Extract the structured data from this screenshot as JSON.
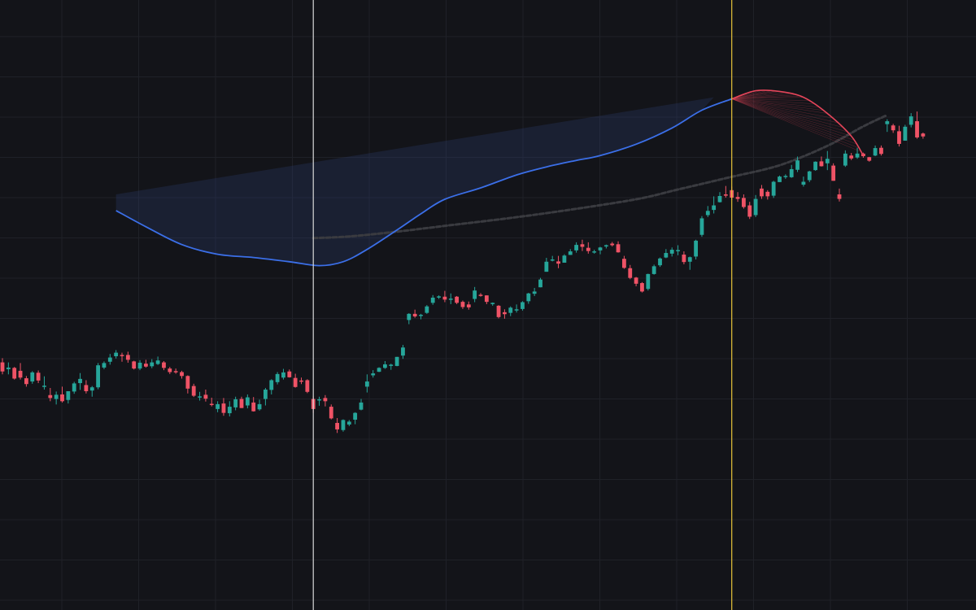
{
  "colors": {
    "background": "#131419",
    "grid": "#1f2128",
    "up": "#26a69a",
    "down": "#ef5366",
    "fit_curve": "#3b6fe8",
    "fit_fill": "#2a3a6a",
    "forecast_curve": "#e5455a",
    "slow_average": "#3a3b40",
    "cursor_white": "#d9d9d9",
    "cursor_yellow": "#e8c53a"
  },
  "chart_data": {
    "type": "candlestick",
    "grid": true,
    "axis_labels_shown": false,
    "xlim": [
      0,
      148
    ],
    "ylim": [
      0,
      100
    ],
    "vertical_markers": [
      {
        "x": 52,
        "color": "white"
      },
      {
        "x": 122,
        "color": "yellow"
      }
    ],
    "candles": [
      {
        "o": 48.1,
        "h": 49.4,
        "l": 44.4,
        "c": 45.3
      },
      {
        "o": 46.0,
        "h": 48.1,
        "l": 44.4,
        "c": 46.5
      },
      {
        "o": 46.4,
        "h": 46.7,
        "l": 42.8,
        "c": 43.1
      },
      {
        "o": 45.5,
        "h": 47.9,
        "l": 42.8,
        "c": 43.4
      },
      {
        "o": 43.2,
        "h": 43.9,
        "l": 40.6,
        "c": 41.4
      },
      {
        "o": 42.2,
        "h": 45.4,
        "l": 41.5,
        "c": 45.0
      },
      {
        "o": 44.9,
        "h": 45.6,
        "l": 41.7,
        "c": 42.5
      },
      {
        "o": 40.9,
        "h": 43.8,
        "l": 39.7,
        "c": 40.9
      },
      {
        "o": 38.0,
        "h": 40.2,
        "l": 36.1,
        "c": 37.1
      },
      {
        "o": 36.8,
        "h": 39.1,
        "l": 35.1,
        "c": 38.1
      },
      {
        "o": 38.2,
        "h": 40.6,
        "l": 35.7,
        "c": 36.1
      },
      {
        "o": 36.5,
        "h": 39.2,
        "l": 35.4,
        "c": 39.2
      },
      {
        "o": 39.1,
        "h": 42.1,
        "l": 38.4,
        "c": 41.6
      },
      {
        "o": 41.7,
        "h": 44.8,
        "l": 39.6,
        "c": 43.0
      },
      {
        "o": 41.1,
        "h": 42.6,
        "l": 38.5,
        "c": 39.2
      },
      {
        "o": 39.4,
        "h": 40.8,
        "l": 37.5,
        "c": 40.4
      },
      {
        "o": 40.4,
        "h": 47.9,
        "l": 39.8,
        "c": 47.2
      },
      {
        "o": 46.5,
        "h": 48.4,
        "l": 46.0,
        "c": 47.9
      },
      {
        "o": 48.3,
        "h": 50.7,
        "l": 47.4,
        "c": 49.6
      },
      {
        "o": 50.0,
        "h": 51.9,
        "l": 49.3,
        "c": 51.1
      },
      {
        "o": 50.4,
        "h": 51.1,
        "l": 48.3,
        "c": 50.3
      },
      {
        "o": 50.4,
        "h": 51.4,
        "l": 48.0,
        "c": 48.9
      },
      {
        "o": 48.4,
        "h": 48.6,
        "l": 45.9,
        "c": 46.2
      },
      {
        "o": 46.2,
        "h": 48.8,
        "l": 45.7,
        "c": 48.0
      },
      {
        "o": 47.7,
        "h": 48.9,
        "l": 46.5,
        "c": 46.8
      },
      {
        "o": 46.9,
        "h": 49.1,
        "l": 46.3,
        "c": 48.1
      },
      {
        "o": 47.6,
        "h": 49.9,
        "l": 47.3,
        "c": 48.7
      },
      {
        "o": 48.1,
        "h": 48.5,
        "l": 45.7,
        "c": 46.4
      },
      {
        "o": 46.2,
        "h": 46.7,
        "l": 44.5,
        "c": 45.1
      },
      {
        "o": 45.4,
        "h": 46.2,
        "l": 44.6,
        "c": 45.1
      },
      {
        "o": 45.1,
        "h": 45.5,
        "l": 43.1,
        "c": 43.9
      },
      {
        "o": 43.9,
        "h": 44.1,
        "l": 38.5,
        "c": 40.0
      },
      {
        "o": 40.8,
        "h": 41.5,
        "l": 37.4,
        "c": 37.8
      },
      {
        "o": 37.6,
        "h": 39.0,
        "l": 36.3,
        "c": 37.6
      },
      {
        "o": 38.1,
        "h": 39.7,
        "l": 36.0,
        "c": 36.9
      },
      {
        "o": 35.3,
        "h": 37.2,
        "l": 34.5,
        "c": 35.2
      },
      {
        "o": 33.7,
        "h": 36.1,
        "l": 32.7,
        "c": 35.2
      },
      {
        "o": 35.4,
        "h": 37.1,
        "l": 31.6,
        "c": 32.5
      },
      {
        "o": 32.4,
        "h": 36.1,
        "l": 31.4,
        "c": 34.4
      },
      {
        "o": 34.2,
        "h": 37.5,
        "l": 33.3,
        "c": 36.7
      },
      {
        "o": 36.8,
        "h": 37.5,
        "l": 34.0,
        "c": 34.0
      },
      {
        "o": 34.8,
        "h": 38.2,
        "l": 33.9,
        "c": 37.3
      },
      {
        "o": 35.7,
        "h": 37.4,
        "l": 32.9,
        "c": 33.0
      },
      {
        "o": 33.6,
        "h": 36.6,
        "l": 33.2,
        "c": 35.2
      },
      {
        "o": 36.8,
        "h": 40.2,
        "l": 34.8,
        "c": 39.7
      },
      {
        "o": 39.6,
        "h": 42.9,
        "l": 38.2,
        "c": 42.6
      },
      {
        "o": 42.0,
        "h": 45.1,
        "l": 41.3,
        "c": 44.5
      },
      {
        "o": 43.4,
        "h": 46.1,
        "l": 42.8,
        "c": 45.0
      },
      {
        "o": 45.3,
        "h": 45.9,
        "l": 43.4,
        "c": 43.5
      },
      {
        "o": 43.3,
        "h": 44.6,
        "l": 40.3,
        "c": 40.5
      },
      {
        "o": 42.5,
        "h": 43.4,
        "l": 41.4,
        "c": 42.3
      },
      {
        "o": 42.6,
        "h": 42.9,
        "l": 38.6,
        "c": 39.0
      },
      {
        "o": 36.8,
        "h": 37.6,
        "l": 32.5,
        "c": 33.7
      },
      {
        "o": 36.5,
        "h": 37.5,
        "l": 34.7,
        "c": 36.7
      },
      {
        "o": 37.1,
        "h": 38.0,
        "l": 34.5,
        "c": 36.1
      },
      {
        "o": 34.4,
        "h": 35.1,
        "l": 30.5,
        "c": 30.8
      },
      {
        "o": 29.4,
        "h": 30.9,
        "l": 26.3,
        "c": 27.4
      },
      {
        "o": 27.2,
        "h": 30.5,
        "l": 26.7,
        "c": 30.3
      },
      {
        "o": 28.9,
        "h": 30.3,
        "l": 28.4,
        "c": 29.8
      },
      {
        "o": 30.4,
        "h": 32.7,
        "l": 29.0,
        "c": 32.5
      },
      {
        "o": 33.5,
        "h": 36.8,
        "l": 33.3,
        "c": 35.7
      },
      {
        "o": 40.6,
        "h": 44.4,
        "l": 38.8,
        "c": 42.2
      },
      {
        "o": 44.1,
        "h": 45.7,
        "l": 43.4,
        "c": 44.7
      },
      {
        "o": 45.2,
        "h": 46.6,
        "l": 45.1,
        "c": 46.4
      },
      {
        "o": 46.4,
        "h": 48.5,
        "l": 46.1,
        "c": 47.5
      },
      {
        "o": 47.0,
        "h": 47.7,
        "l": 45.8,
        "c": 47.4
      },
      {
        "o": 47.0,
        "h": 49.8,
        "l": 46.9,
        "c": 49.8
      },
      {
        "o": 50.2,
        "h": 53.5,
        "l": 49.2,
        "c": 52.7
      },
      {
        "o": 61.2,
        "h": 63.3,
        "l": 59.9,
        "c": 63.1
      },
      {
        "o": 63.1,
        "h": 64.4,
        "l": 61.9,
        "c": 62.3
      },
      {
        "o": 62.5,
        "h": 63.1,
        "l": 61.4,
        "c": 62.8
      },
      {
        "o": 63.4,
        "h": 65.8,
        "l": 63.1,
        "c": 65.4
      },
      {
        "o": 66.5,
        "h": 68.9,
        "l": 65.9,
        "c": 68.1
      },
      {
        "o": 68.3,
        "h": 68.8,
        "l": 67.7,
        "c": 68.5
      },
      {
        "o": 68.4,
        "h": 70.2,
        "l": 66.7,
        "c": 67.5
      },
      {
        "o": 67.8,
        "h": 69.4,
        "l": 66.1,
        "c": 67.8
      },
      {
        "o": 68.4,
        "h": 68.6,
        "l": 66.1,
        "c": 66.5
      },
      {
        "o": 66.8,
        "h": 67.2,
        "l": 64.6,
        "c": 65.2
      },
      {
        "o": 66.0,
        "h": 66.9,
        "l": 64.4,
        "c": 65.1
      },
      {
        "o": 67.7,
        "h": 71.4,
        "l": 66.7,
        "c": 70.3
      },
      {
        "o": 69.0,
        "h": 69.5,
        "l": 68.4,
        "c": 68.9
      },
      {
        "o": 68.8,
        "h": 68.8,
        "l": 66.1,
        "c": 66.8
      },
      {
        "o": 66.1,
        "h": 66.6,
        "l": 65.6,
        "c": 66.5
      },
      {
        "o": 65.6,
        "h": 65.8,
        "l": 61.7,
        "c": 62.1
      },
      {
        "o": 63.6,
        "h": 64.5,
        "l": 61.6,
        "c": 63.0
      },
      {
        "o": 63.4,
        "h": 65.4,
        "l": 62.4,
        "c": 65.0
      },
      {
        "o": 64.3,
        "h": 66.0,
        "l": 63.5,
        "c": 64.5
      },
      {
        "o": 64.6,
        "h": 67.0,
        "l": 64.1,
        "c": 66.7
      },
      {
        "o": 67.0,
        "h": 69.6,
        "l": 66.2,
        "c": 69.4
      },
      {
        "o": 69.3,
        "h": 71.1,
        "l": 68.6,
        "c": 70.0
      },
      {
        "o": 71.3,
        "h": 74.2,
        "l": 71.3,
        "c": 73.7
      },
      {
        "o": 76.1,
        "h": 80.4,
        "l": 76.1,
        "c": 79.2
      },
      {
        "o": 79.6,
        "h": 81.0,
        "l": 79.3,
        "c": 79.9
      },
      {
        "o": 79.3,
        "h": 81.0,
        "l": 77.2,
        "c": 78.6
      },
      {
        "o": 78.9,
        "h": 81.5,
        "l": 78.9,
        "c": 81.1
      },
      {
        "o": 81.3,
        "h": 83.1,
        "l": 81.3,
        "c": 82.4
      },
      {
        "o": 82.7,
        "h": 85.2,
        "l": 82.0,
        "c": 84.4
      },
      {
        "o": 84.6,
        "h": 86.0,
        "l": 82.5,
        "c": 83.8
      },
      {
        "o": 83.5,
        "h": 85.2,
        "l": 81.7,
        "c": 82.5
      },
      {
        "o": 82.4,
        "h": 82.9,
        "l": 81.7,
        "c": 82.4
      },
      {
        "o": 82.7,
        "h": 83.8,
        "l": 81.5,
        "c": 83.6
      },
      {
        "o": 83.9,
        "h": 84.5,
        "l": 83.3,
        "c": 84.3
      },
      {
        "o": 84.8,
        "h": 85.3,
        "l": 83.9,
        "c": 84.3
      },
      {
        "o": 84.6,
        "h": 85.5,
        "l": 82.0,
        "c": 82.1
      },
      {
        "o": 80.1,
        "h": 81.0,
        "l": 77.0,
        "c": 77.3
      },
      {
        "o": 77.2,
        "h": 78.2,
        "l": 73.8,
        "c": 74.2
      },
      {
        "o": 74.3,
        "h": 74.5,
        "l": 71.6,
        "c": 72.4
      },
      {
        "o": 72.6,
        "h": 72.9,
        "l": 69.7,
        "c": 70.0
      },
      {
        "o": 70.8,
        "h": 75.5,
        "l": 70.3,
        "c": 75.4
      },
      {
        "o": 75.4,
        "h": 78.3,
        "l": 75.2,
        "c": 77.8
      },
      {
        "o": 78.1,
        "h": 80.5,
        "l": 77.6,
        "c": 80.2
      },
      {
        "o": 80.5,
        "h": 83.1,
        "l": 80.3,
        "c": 81.9
      },
      {
        "o": 81.7,
        "h": 83.6,
        "l": 80.8,
        "c": 82.9
      },
      {
        "o": 82.6,
        "h": 84.3,
        "l": 81.2,
        "c": 82.8
      },
      {
        "o": 81.4,
        "h": 82.4,
        "l": 78.4,
        "c": 79.1
      },
      {
        "o": 79.2,
        "h": 80.8,
        "l": 76.7,
        "c": 80.6
      },
      {
        "o": 80.8,
        "h": 86.0,
        "l": 79.9,
        "c": 85.7
      },
      {
        "o": 87.5,
        "h": 93.3,
        "l": 86.9,
        "c": 92.6
      },
      {
        "o": 93.6,
        "h": 96.4,
        "l": 93.0,
        "c": 94.9
      },
      {
        "o": 95.2,
        "h": 99.4,
        "l": 94.1,
        "c": 96.6
      },
      {
        "o": 97.6,
        "h": 100.7,
        "l": 97.5,
        "c": 99.5
      },
      {
        "o": 100.0,
        "h": 102.6,
        "l": 99.0,
        "c": 99.6
      },
      {
        "o": 101.3,
        "h": 102.4,
        "l": 98.3,
        "c": 99.0
      },
      {
        "o": 99.2,
        "h": 100.7,
        "l": 97.7,
        "c": 98.6
      },
      {
        "o": 98.9,
        "h": 100.0,
        "l": 95.6,
        "c": 96.1
      },
      {
        "o": 96.6,
        "h": 97.7,
        "l": 92.4,
        "c": 93.1
      },
      {
        "o": 93.6,
        "h": 99.8,
        "l": 93.0,
        "c": 98.6
      },
      {
        "o": 101.8,
        "h": 102.9,
        "l": 98.6,
        "c": 99.4
      },
      {
        "o": 100.8,
        "h": 101.3,
        "l": 98.4,
        "c": 99.4
      },
      {
        "o": 99.6,
        "h": 104.2,
        "l": 98.9,
        "c": 103.9
      },
      {
        "o": 103.8,
        "h": 105.8,
        "l": 103.8,
        "c": 105.5
      },
      {
        "o": 105.4,
        "h": 106.2,
        "l": 104.8,
        "c": 105.7
      },
      {
        "o": 105.3,
        "h": 109.1,
        "l": 105.1,
        "c": 107.8
      },
      {
        "o": 107.6,
        "h": 111.7,
        "l": 106.9,
        "c": 110.5
      },
      {
        "o": 103.0,
        "h": 105.5,
        "l": 102.4,
        "c": 103.9
      },
      {
        "o": 104.4,
        "h": 107.3,
        "l": 103.8,
        "c": 107.1
      },
      {
        "o": 107.5,
        "h": 110.2,
        "l": 107.3,
        "c": 110.1
      },
      {
        "o": 110.2,
        "h": 111.7,
        "l": 108.6,
        "c": 108.7
      },
      {
        "o": 109.6,
        "h": 113.4,
        "l": 107.5,
        "c": 111.0
      },
      {
        "o": 108.9,
        "h": 109.6,
        "l": 104.2,
        "c": 104.2
      },
      {
        "o": 100.0,
        "h": 101.8,
        "l": 97.8,
        "c": 98.6
      },
      {
        "o": 108.9,
        "h": 113.6,
        "l": 108.5,
        "c": 112.6
      },
      {
        "o": 112.0,
        "h": 112.8,
        "l": 110.6,
        "c": 111.1
      },
      {
        "o": 111.4,
        "h": 114.4,
        "l": 111.0,
        "c": 112.6
      },
      {
        "o": 112.6,
        "h": 112.9,
        "l": 111.3,
        "c": 111.8
      },
      {
        "o": 111.5,
        "h": 111.6,
        "l": 110.1,
        "c": 110.4
      },
      {
        "o": 112.0,
        "h": 115.1,
        "l": 111.8,
        "c": 114.3
      },
      {
        "o": 114.4,
        "h": 115.1,
        "l": 112.0,
        "c": 112.5
      },
      {
        "o": 121.7,
        "h": 123.2,
        "l": 119.3,
        "c": 122.6
      },
      {
        "o": 121.3,
        "h": 121.8,
        "l": 119.0,
        "c": 119.8
      },
      {
        "o": 119.5,
        "h": 121.2,
        "l": 114.8,
        "c": 115.6
      },
      {
        "o": 116.6,
        "h": 121.5,
        "l": 116.6,
        "c": 120.9
      },
      {
        "o": 121.5,
        "h": 125.1,
        "l": 120.7,
        "c": 124.1
      },
      {
        "o": 122.6,
        "h": 125.6,
        "l": 117.2,
        "c": 117.6
      },
      {
        "o": 118.8,
        "h": 119.1,
        "l": 117.2,
        "c": 117.9
      }
    ],
    "series": [
      {
        "type": "fit",
        "points": [
          [
            19,
            95.0
          ],
          [
            24,
            90.0
          ],
          [
            30,
            84.5
          ],
          [
            36,
            81.5
          ],
          [
            42,
            80.5
          ],
          [
            48,
            79.2
          ],
          [
            53,
            78.0
          ],
          [
            57,
            79.2
          ],
          [
            61,
            83.0
          ],
          [
            66,
            89.0
          ],
          [
            70,
            94.0
          ],
          [
            74,
            98.5
          ],
          [
            80,
            102.0
          ],
          [
            86,
            106.0
          ],
          [
            91,
            108.5
          ],
          [
            96,
            110.5
          ],
          [
            100,
            112.0
          ],
          [
            106,
            115.5
          ],
          [
            112,
            120.5
          ],
          [
            117,
            126.0
          ],
          [
            122,
            129.5
          ]
        ]
      },
      {
        "type": "forecast",
        "points": [
          [
            122,
            129.5
          ],
          [
            126,
            132.0
          ],
          [
            130,
            131.8
          ],
          [
            134,
            130.0
          ],
          [
            138,
            125.0
          ],
          [
            142,
            118.0
          ],
          [
            144,
            112.0
          ]
        ]
      },
      {
        "type": "band_top",
        "points": [
          [
            19,
            100.0
          ],
          [
            119,
            130.0
          ]
        ]
      },
      {
        "type": "slow_average",
        "points": [
          [
            52,
            86.5
          ],
          [
            58,
            87.0
          ],
          [
            66,
            88.5
          ],
          [
            75,
            90.5
          ],
          [
            84,
            92.5
          ],
          [
            94,
            95.0
          ],
          [
            106,
            98.5
          ],
          [
            113,
            101.5
          ],
          [
            121,
            105.0
          ],
          [
            130,
            109.0
          ],
          [
            138,
            115.0
          ],
          [
            144,
            121.0
          ],
          [
            148,
            124.5
          ]
        ]
      }
    ]
  }
}
